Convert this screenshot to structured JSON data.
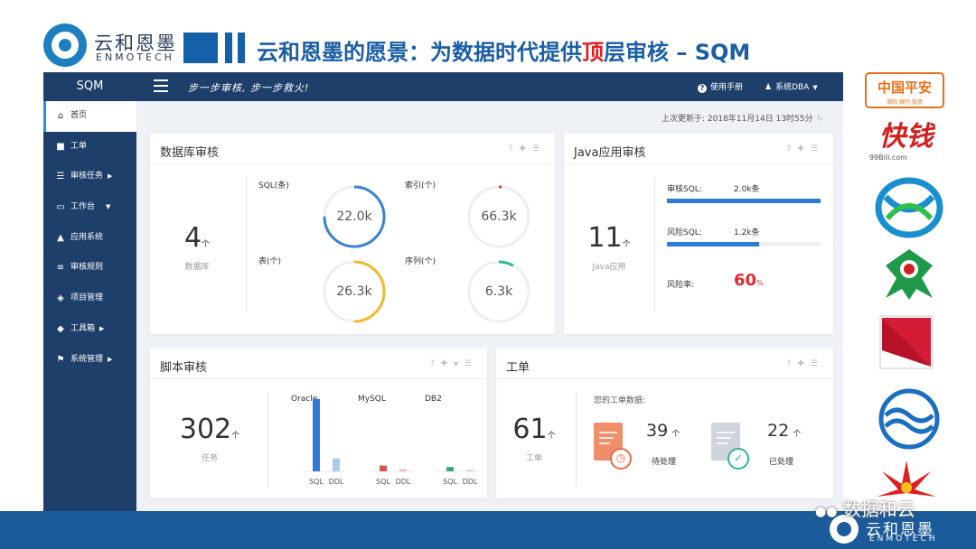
{
  "slide": {
    "logo_cn": "云和恩墨",
    "logo_en": "ENMOTECH",
    "title_pre": "云和恩墨的愿景：为数据时代提供",
    "title_red": "顶",
    "title_post": "层审核 – SQM",
    "right_logos": [
      {
        "name": "中国平安",
        "sub": "保险·银行·投资"
      },
      {
        "name": "快钱",
        "sub": "99Bill.com"
      }
    ],
    "watermark": "数据和云",
    "footer_logo_cn": "云和恩墨",
    "footer_logo_en": "ENMOTECH",
    "colors": {
      "brand_blue": "#1b5ea6",
      "title_red": "#e02020",
      "nav_dark": "#1f3f6b"
    }
  },
  "app": {
    "brand": "SQM",
    "slogan": "步一步审核, 步一步救火!",
    "help_label": "使用手册",
    "user_label": "系统DBA",
    "last_updated_label": "上次更新于:",
    "last_updated_value": "2018年11月14日 13时55分",
    "sidebar": [
      {
        "label": "首页",
        "icon": "home-icon",
        "active": true
      },
      {
        "label": "工单",
        "icon": "document-icon"
      },
      {
        "label": "审核任务",
        "icon": "task-list-icon",
        "arrow": "▶"
      },
      {
        "label": "工作台",
        "icon": "laptop-icon",
        "arrow": "▼"
      },
      {
        "label": "应用系统",
        "icon": "sitemap-icon"
      },
      {
        "label": "审核规则",
        "icon": "sliders-icon"
      },
      {
        "label": "项目管理",
        "icon": "cube-outline-icon"
      },
      {
        "label": "工具箱",
        "icon": "cube-icon",
        "arrow": "▶"
      },
      {
        "label": "系统管理",
        "icon": "flag-icon",
        "arrow": "▶"
      }
    ],
    "db_audit": {
      "title": "数据库审核",
      "count": "4",
      "unit": "个",
      "count_label": "数据库",
      "rings": [
        {
          "label": "SQL(条)",
          "value": "22.0k",
          "fill": 0.75,
          "color": "#3b82d1"
        },
        {
          "label": "索引(个)",
          "value": "66.3k",
          "fill": 0.015,
          "color": "#e0453a"
        },
        {
          "label": "表(个)",
          "value": "26.3k",
          "fill": 0.5,
          "color": "#f2b830"
        },
        {
          "label": "序列(个)",
          "value": "6.3k",
          "fill": 0.08,
          "color": "#2fb89a"
        }
      ]
    },
    "java_audit": {
      "title": "Java应用审核",
      "count": "11",
      "unit": "个",
      "count_label": "Java应用",
      "audit_sql_label": "审核SQL:",
      "audit_sql_value": "2.0k条",
      "audit_sql_fill": 1.0,
      "risk_sql_label": "风险SQL:",
      "risk_sql_value": "1.2k条",
      "risk_sql_fill": 0.6,
      "risk_rate_label": "风险率:",
      "risk_rate_value": "60",
      "risk_rate_unit": "%"
    },
    "script_audit": {
      "title": "脚本审核",
      "count": "302",
      "unit": "个",
      "count_label": "任务"
    },
    "tickets": {
      "title": "工单",
      "count": "61",
      "unit": "个",
      "count_label": "工单",
      "my_data_label": "您的工单数据:",
      "pending_count": "39",
      "pending_unit": "个",
      "pending_label": "待处理",
      "done_count": "22",
      "done_unit": "个",
      "done_label": "已处理"
    }
  },
  "chart_data": {
    "type": "bar",
    "title": "",
    "groups": [
      "Oracle",
      "MySQL",
      "DB2"
    ],
    "categories": [
      "SQL",
      "DDL"
    ],
    "series": [
      {
        "group": "Oracle",
        "values": [
          100,
          18
        ]
      },
      {
        "group": "MySQL",
        "values": [
          8,
          3
        ]
      },
      {
        "group": "DB2",
        "values": [
          6,
          2
        ]
      }
    ],
    "group_colors": [
      [
        "#2f7cd6",
        "#a9c9ee"
      ],
      [
        "#d9534f",
        "#f0b9b7"
      ],
      [
        "#2fa87a",
        "#b7e2cf"
      ]
    ],
    "ylim": [
      0,
      100
    ]
  }
}
